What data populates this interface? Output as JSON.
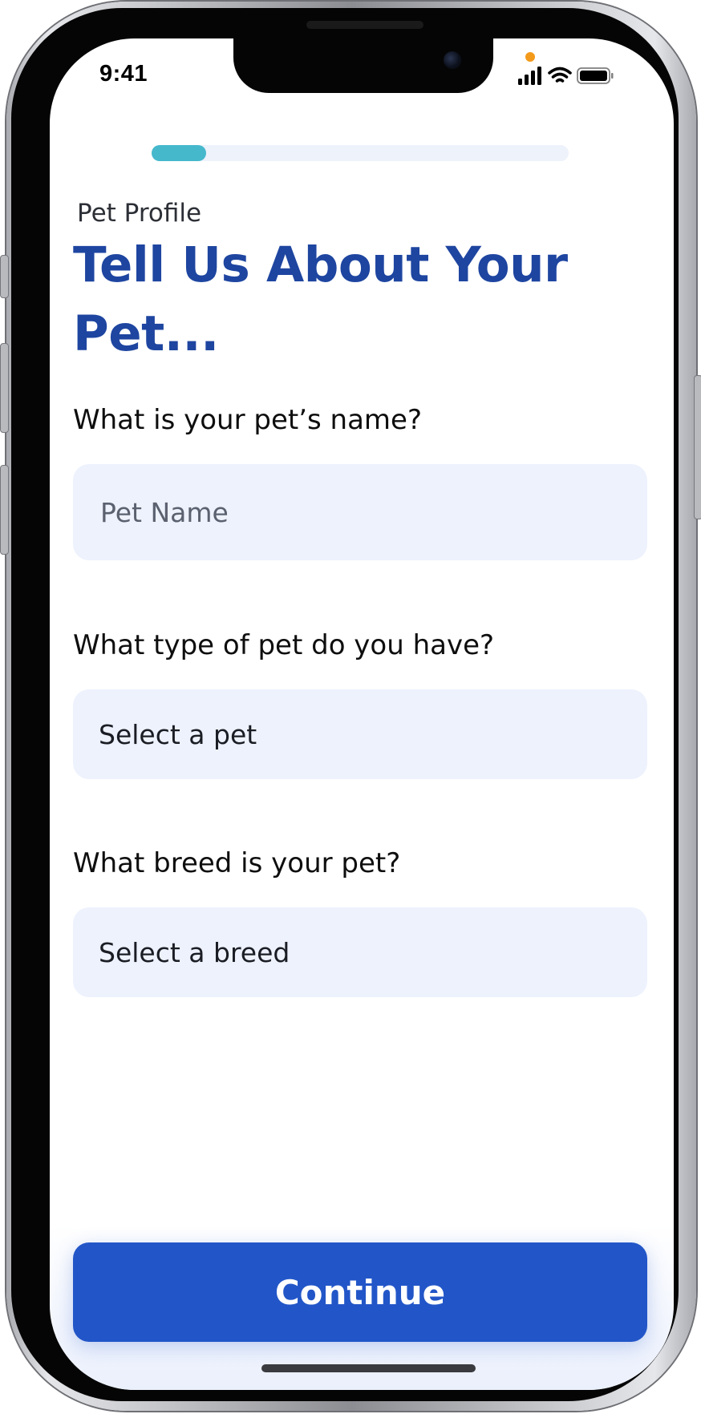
{
  "status_bar": {
    "time": "9:41",
    "icons": [
      "cellular-signal-icon",
      "wifi-icon",
      "battery-icon"
    ],
    "privacy_indicator_color": "#f39a1b"
  },
  "progress": {
    "value": 0.13,
    "track_color": "#edf2fb",
    "fill_color": "#45b8cc"
  },
  "header": {
    "overline": "Pet Profile",
    "title": "Tell Us About Your Pet..."
  },
  "form": {
    "name": {
      "label": "What is your pet’s name?",
      "placeholder": "Pet Name",
      "value": ""
    },
    "type": {
      "label": "What type of pet do you have?",
      "selected": "Select a pet"
    },
    "breed": {
      "label": "What breed is your pet?",
      "selected": "Select a breed"
    }
  },
  "actions": {
    "continue_label": "Continue"
  },
  "colors": {
    "accent_title": "#1e45a0",
    "primary_button": "#2256c8",
    "field_background": "#edf2fd"
  }
}
